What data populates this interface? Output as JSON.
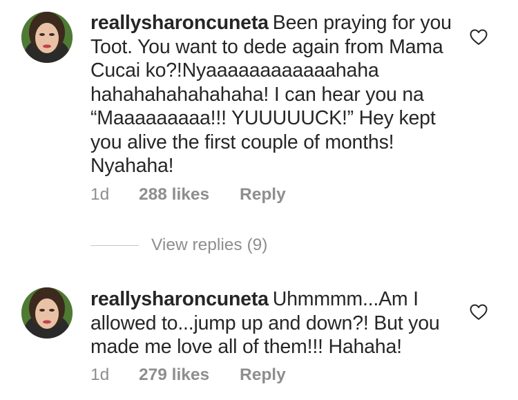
{
  "comments": [
    {
      "username": "reallysharoncuneta",
      "text": "Been praying for you Toot. You want to dede again from Mama Cucai ko?!Nyaaaaaaaaaaaahaha hahahahahahahaha! I can hear you na “Maaaaaaaaa!!! YUUUUUCK!” Hey kept you alive the first couple of months! Nyahaha!",
      "time": "1d",
      "likes": "288 likes",
      "reply": "Reply",
      "view_replies": "View replies (9)",
      "like_icon": "heart-outline-icon"
    },
    {
      "username": "reallysharoncuneta",
      "text": "Uhmmmm...Am I allowed to...jump up and down?! But you made me love all of them!!! Hahaha!",
      "time": "1d",
      "likes": "279 likes",
      "reply": "Reply",
      "like_icon": "heart-outline-icon"
    }
  ],
  "colors": {
    "text": "#262626",
    "secondary": "#8e8e8e",
    "divider": "#c7c7c7"
  }
}
